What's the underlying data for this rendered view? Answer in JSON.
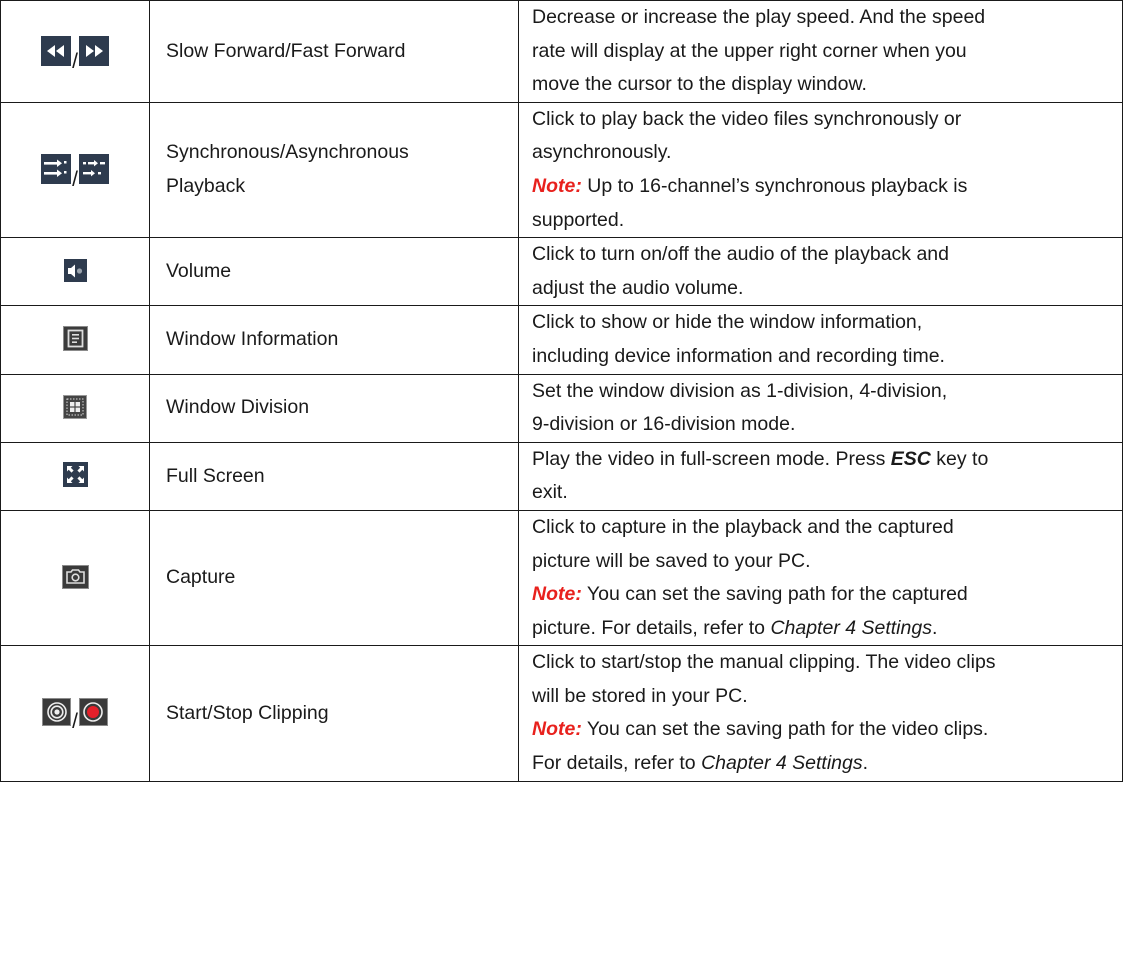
{
  "rows": [
    {
      "name_lines": [
        "Slow Forward/Fast Forward"
      ],
      "icons": [
        "slow-forward-icon",
        "fast-forward-icon"
      ],
      "desc_lines": [
        "Decrease or increase the play speed. And the speed",
        "rate will display at the upper right corner when you",
        "move the cursor to the display window."
      ]
    },
    {
      "name_lines": [
        "Synchronous/Asynchronous",
        "Playback"
      ],
      "icons": [
        "synchronous-playback-icon",
        "asynchronous-playback-icon"
      ],
      "desc_lines": [
        "Click to play back the video files synchronously or",
        "asynchronously."
      ],
      "note_label": "Note:",
      "note_lines": [
        " Up to 16-channel’s synchronous playback is",
        "supported."
      ]
    },
    {
      "name_lines": [
        "Volume"
      ],
      "icons": [
        "volume-icon"
      ],
      "desc_lines": [
        "Click to turn on/off the audio of the playback and",
        "adjust the audio volume."
      ]
    },
    {
      "name_lines": [
        "Window Information"
      ],
      "icons": [
        "window-information-icon"
      ],
      "desc_lines": [
        "Click to show or hide the window information,",
        "including device information and recording time."
      ]
    },
    {
      "name_lines": [
        "Window Division"
      ],
      "icons": [
        "window-division-icon"
      ],
      "desc_lines": [
        "Set the window division as 1-division, 4-division,",
        "9-division or 16-division mode."
      ]
    },
    {
      "name_lines": [
        "Full Screen"
      ],
      "icons": [
        "full-screen-icon"
      ],
      "desc_a": "Play the video in full-screen mode. Press ",
      "desc_key": "ESC",
      "desc_b": " key to",
      "desc_c": "exit."
    },
    {
      "name_lines": [
        "Capture"
      ],
      "icons": [
        "capture-icon"
      ],
      "desc_lines": [
        "Click to capture in the playback and the captured",
        "picture will be saved to your PC."
      ],
      "note_label": "Note:",
      "note_line1": " You can set the saving path for the captured",
      "note_line2_a": "picture. For details, refer to ",
      "note_line2_ref": "Chapter 4 Settings",
      "note_line2_b": "."
    },
    {
      "name_lines": [
        "Start/Stop Clipping"
      ],
      "icons": [
        "start-clipping-icon",
        "stop-clipping-icon"
      ],
      "desc_lines": [
        "Click to start/stop the manual clipping. The video clips",
        "will be stored in your PC."
      ],
      "note_label": "Note:",
      "note_line1": " You can set the saving path for the video clips.",
      "note_line2_a": "For details, refer to ",
      "note_line2_ref": "Chapter 4 Settings",
      "note_line2_b": "."
    }
  ],
  "separator": "/"
}
